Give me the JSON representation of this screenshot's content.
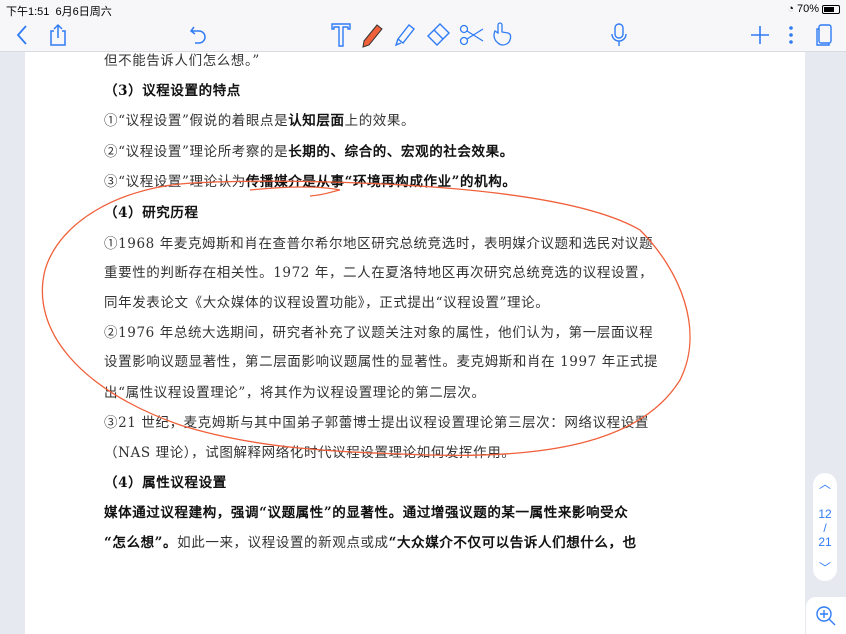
{
  "status": {
    "time": "下午1:51",
    "date": "6月6日周六",
    "battery": "70%",
    "battery_level": 0.7
  },
  "toolbar": {
    "icons": [
      "back-icon",
      "share-icon",
      "undo-icon",
      "text-tool-icon",
      "pen-icon",
      "highlighter-icon",
      "eraser-icon",
      "scissors-icon",
      "hand-gesture-icon",
      "microphone-icon",
      "add-icon",
      "more-icon",
      "pages-icon"
    ],
    "accent": "#2f7cf6",
    "pen_color": "#f0603a"
  },
  "document": {
    "lines": [
      [
        {
          "t": "但不能告诉人们怎么想。”",
          "b": false
        }
      ],
      [
        {
          "t": "（3）议程设置的特点",
          "b": true
        }
      ],
      [
        {
          "t": "①“议程设置”假说的着眼点是",
          "b": false
        },
        {
          "t": "认知层面",
          "b": true
        },
        {
          "t": "上的效果。",
          "b": false
        }
      ],
      [
        {
          "t": "②“议程设置”理论所考察的是",
          "b": false
        },
        {
          "t": "长期的、综合的、宏观的社会效果。",
          "b": true
        }
      ],
      [
        {
          "t": "③“议程设置”理论认为",
          "b": false
        },
        {
          "t": "传播媒介是从事“环境再构成作业”的机构。",
          "b": true
        }
      ],
      [
        {
          "t": "（4）研究历程",
          "b": true
        }
      ],
      [
        {
          "t": "①1968 年麦克姆斯和肖在查普尔希尔地区研究总统竞选时，表明媒介议题和选民对议题",
          "b": false
        }
      ],
      [
        {
          "t": "重要性的判断存在相关性。1972 年，二人在夏洛特地区再次研究总统竞选的议程设置，",
          "b": false
        }
      ],
      [
        {
          "t": "同年发表论文《大众媒体的议程设置功能》，正式提出“议程设置”理论。",
          "b": false
        }
      ],
      [
        {
          "t": "②1976 年总统大选期间，研究者补充了议题关注对象的属性，他们认为，第一层面议程",
          "b": false
        }
      ],
      [
        {
          "t": "设置影响议题显著性，第二层面影响议题属性的显著性。麦克姆斯和肖在 1997 年正式提",
          "b": false
        }
      ],
      [
        {
          "t": "出“属性议程设置理论”，将其作为议程设置理论的第二层次。",
          "b": false
        }
      ],
      [
        {
          "t": "③21 世纪，麦克姆斯与其中国弟子郭蕾博士提出议程设置理论第三层次：网络议程设置",
          "b": false
        }
      ],
      [
        {
          "t": "（NAS 理论），试图解释网络化时代议程设置理论如何发挥作用。",
          "b": false
        }
      ],
      [
        {
          "t": "（4）属性议程设置",
          "b": true
        }
      ],
      [
        {
          "t": "媒体通过议程建构，强调“议题属性”的显著性。通过增强议题的某一属性来影响受众",
          "b": true
        }
      ],
      [
        {
          "t": "“怎么想”。",
          "b": true
        },
        {
          "t": "如此一来，议程设置的新观点或成",
          "b": false
        },
        {
          "t": "“大众媒介不仅可以告诉人们想什么，也",
          "b": true
        }
      ]
    ]
  },
  "pager": {
    "current": "12",
    "separator": "/",
    "total": "21"
  }
}
